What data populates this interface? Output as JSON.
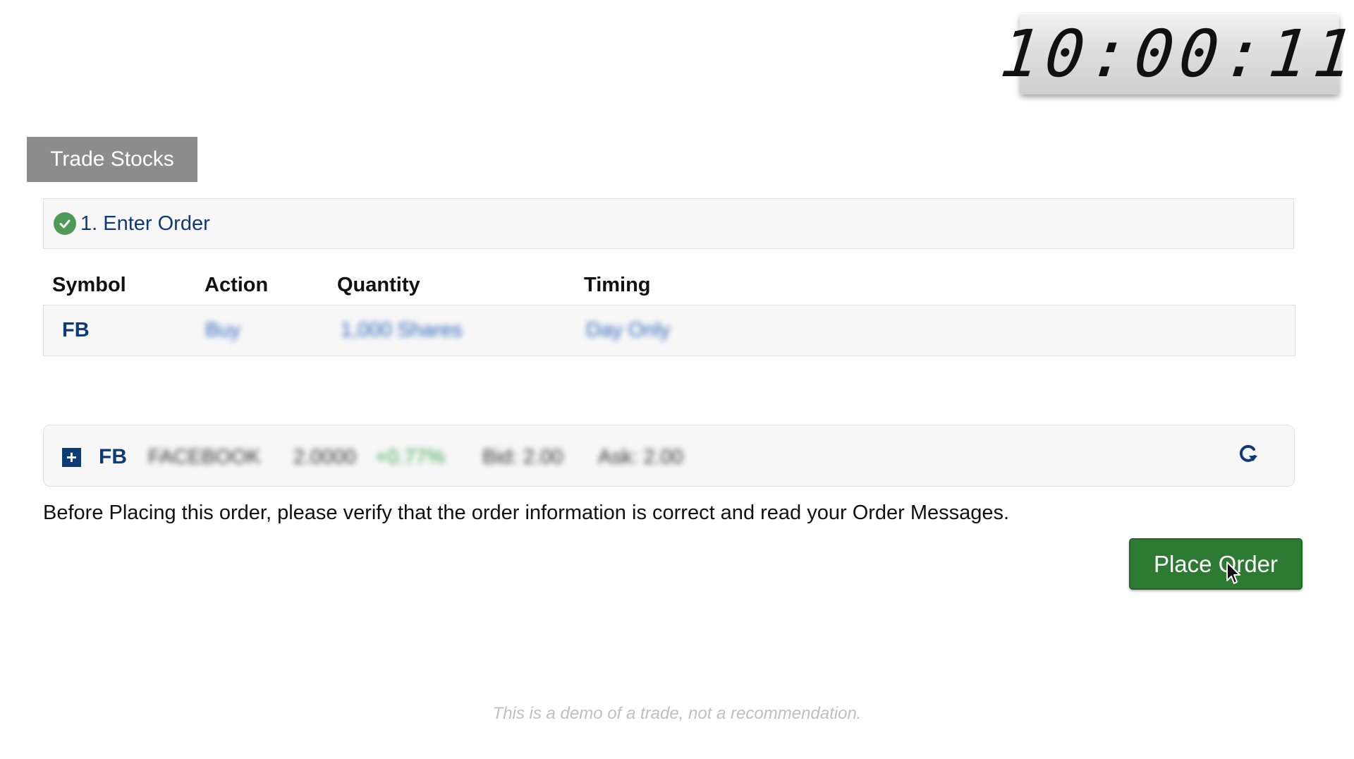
{
  "clock": {
    "time": "10:00:11"
  },
  "tab": {
    "label": "Trade Stocks"
  },
  "step": {
    "title": "1. Enter Order"
  },
  "order_table": {
    "headers": [
      "Symbol",
      "Action",
      "Quantity",
      "Timing"
    ],
    "row": {
      "symbol": "FB",
      "action": "Buy",
      "quantity": "1,000 Shares",
      "timing": "Day Only"
    }
  },
  "quote": {
    "symbol": "FB",
    "name": "FACEBOOK",
    "price": "2.0000",
    "change": "+0.77%",
    "bid": "Bid: 2.00",
    "ask": "Ask: 2.00"
  },
  "notice": "Before Placing this order, please verify that the order information is correct and read your Order Messages.",
  "actions": {
    "place_order": "Place Order"
  },
  "disclaimer": "This is a demo of a trade, not a recommendation.",
  "colors": {
    "accent_blue": "#0f3a78",
    "button_green": "#2d7a33",
    "check_green": "#4c9a55"
  },
  "icons": [
    "check-circle-icon",
    "plus-square-icon",
    "refresh-icon",
    "mouse-cursor-icon"
  ]
}
